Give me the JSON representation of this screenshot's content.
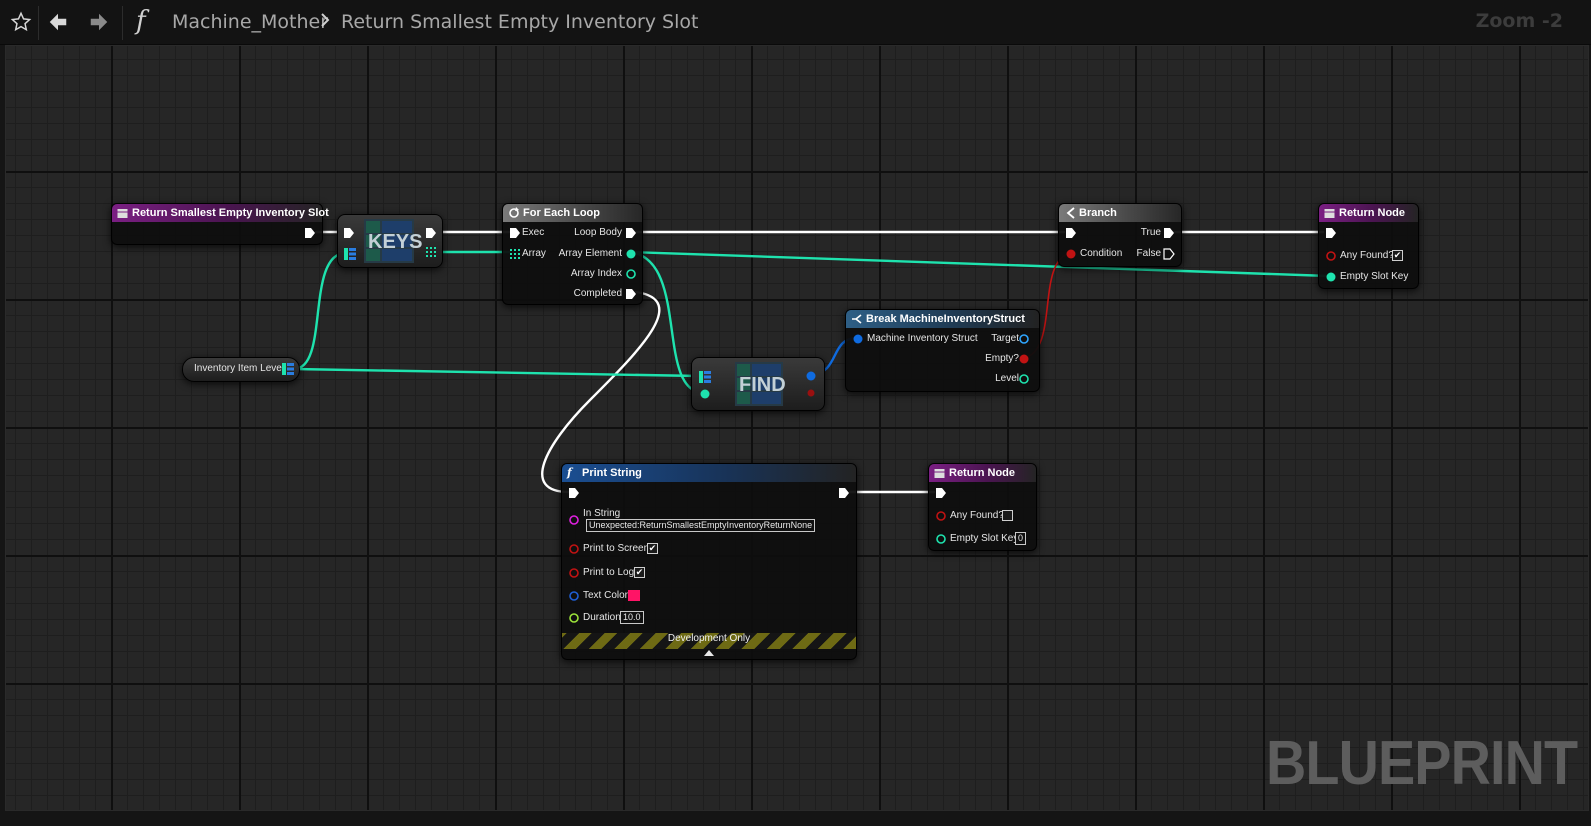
{
  "toolbar": {
    "icons": [
      "star-icon",
      "back-arrow-icon",
      "forward-arrow-icon",
      "function-icon",
      "chevron-right-icon"
    ],
    "breadcrumb_parent": "Machine_Mother",
    "breadcrumb_current": "Return Smallest Empty Inventory Slot",
    "zoom": "Zoom -2"
  },
  "graph": {
    "watermark": "BLUEPRINT",
    "wire_colors": {
      "exec": "#ffffff",
      "integer": "#1ee3ae",
      "struct": "#0f6be0",
      "boolean": "#c11313"
    }
  },
  "nodes": {
    "entry": {
      "title": "Return Smallest Empty Inventory Slot"
    },
    "keys": {
      "title": "KEYS"
    },
    "foreach": {
      "title": "For Each Loop",
      "exec": "Exec",
      "array": "Array",
      "loop_body": "Loop Body",
      "array_element": "Array Element",
      "array_index": "Array Index",
      "completed": "Completed"
    },
    "branch": {
      "title": "Branch",
      "condition": "Condition",
      "true_label": "True",
      "false_label": "False"
    },
    "return1": {
      "title": "Return Node",
      "any_found": "Any Found?",
      "any_found_checked": "✔",
      "empty_slot_key": "Empty Slot Key"
    },
    "variable": {
      "label": "Inventory Item Level"
    },
    "find": {
      "title": "FIND"
    },
    "break": {
      "title": "Break MachineInventoryStruct",
      "input": "Machine Inventory Struct",
      "target": "Target",
      "empty": "Empty?",
      "level": "Level"
    },
    "print": {
      "title": "Print String",
      "in_string": "In String",
      "in_string_value": "Unexpected:ReturnSmallestEmptyInventoryReturnNone",
      "print_to_screen": "Print to Screen",
      "print_to_screen_checked": "✔",
      "print_to_log": "Print to Log",
      "print_to_log_checked": "✔",
      "text_color": "Text Color",
      "text_color_value": "#ff1466",
      "duration": "Duration",
      "duration_value": "10.0",
      "dev_only": "Development Only"
    },
    "return2": {
      "title": "Return Node",
      "any_found": "Any Found?",
      "empty_slot_key": "Empty Slot Key",
      "empty_slot_key_value": "0"
    }
  }
}
